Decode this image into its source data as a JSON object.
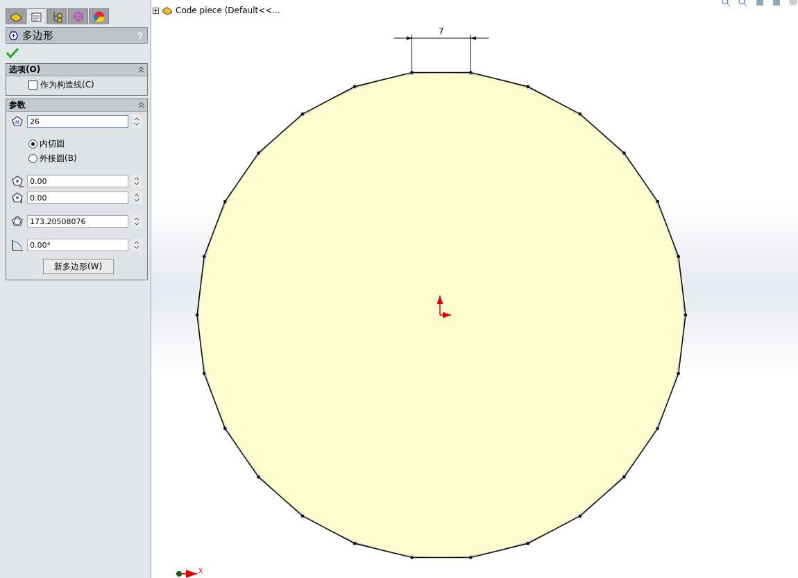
{
  "panel": {
    "tabs": [
      {
        "kind": "part",
        "selected": false
      },
      {
        "kind": "property",
        "selected": true
      },
      {
        "kind": "config",
        "selected": false
      },
      {
        "kind": "target",
        "selected": false
      },
      {
        "kind": "appearance",
        "selected": false
      }
    ],
    "title": "多边形",
    "help": "?",
    "options": {
      "title": "选项(O)",
      "expanded": true,
      "checkbox": {
        "label": "作为构造线(C)",
        "checked": false
      }
    },
    "parameters": {
      "title": "参数",
      "expanded": true,
      "sides": {
        "kind": "sides",
        "value": "26",
        "focused": true
      },
      "radios": [
        {
          "label": "内切圆",
          "selected": true
        },
        {
          "label": "外接圆(B)",
          "selected": false
        }
      ],
      "fields": [
        {
          "kind": "center-x",
          "value": "0.00",
          "focused": false
        },
        {
          "kind": "center-y",
          "value": "0.00",
          "focused": false
        },
        {
          "kind": "diameter",
          "value": "173.20508076",
          "focused": false
        },
        {
          "kind": "angle",
          "value": "0.00°",
          "focused": false
        }
      ],
      "button": "新多边形(W)"
    }
  },
  "tree": {
    "label": "Code piece  (Default<<...",
    "expanded": false
  },
  "canvas": {
    "dimension": "7",
    "axis_label": "X"
  }
}
